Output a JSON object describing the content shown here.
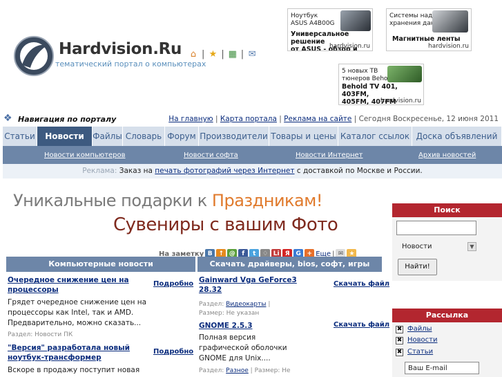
{
  "header": {
    "brand": "Hardvision.Ru",
    "tagline": "тематический портал о компьютерах",
    "tool_icons": [
      "home-icon",
      "star-icon",
      "document-icon",
      "mail-icon"
    ]
  },
  "ads": [
    {
      "text1": "Ноутбук",
      "text2": "ASUS A4B00G",
      "big1": "Универсальное решение",
      "big2": "от ASUS - обзор и тесты",
      "src": "hardvision.ru"
    },
    {
      "text1": "Системы надежного",
      "text2": "хранения данных",
      "big1": "Магнитные ленты",
      "big2": "",
      "src": "hardvision.ru"
    },
    {
      "text1": "5 новых ТВ",
      "text2": "тюнеров Beholder",
      "big1": "Behold TV 401, 403FM,",
      "big2": "405FM, 407FM",
      "src": "hardvision.ru"
    }
  ],
  "nav": {
    "title": "Навигация по порталу",
    "links": [
      "На главную",
      "Карта портала",
      "Реклама на сайте"
    ],
    "date": "Сегодня Воскресенье, 12 июня 2011",
    "tabs": [
      "Статьи",
      "Новости",
      "Файлы",
      "Словарь",
      "Форум",
      "Производители",
      "Товары и цены",
      "Каталог ссылок",
      "Доска объявлений"
    ],
    "active_tab": "Новости",
    "subnav": [
      "Новости компьютеров",
      "Новости софта",
      "Новости Интернет",
      "Архив новостей"
    ]
  },
  "promo": {
    "label": "Реклама:",
    "pre": "Заказ на",
    "link": "печать фотографий через Интернет",
    "post": "с доставкой по Москве и России."
  },
  "banner": {
    "line1_a": "Уникальные подарки к ",
    "line1_b": "Праздникам!",
    "line2": "Сувениры с вашим Фото"
  },
  "share": {
    "label": "На заметку",
    "more": "Еще"
  },
  "news": {
    "heading": "Компьютерные новости",
    "more_label": "Подробно",
    "items": [
      {
        "title1": "Очередное снижение цен на",
        "title2": "процессоры",
        "desc1": "Грядет очередное снижение цен на",
        "desc2": "процессоры как Intel, так и AMD.",
        "desc3": "Предварительно, можно сказать...",
        "meta": "Раздел: Новости ПК"
      },
      {
        "title1": "\"Версия\" разработала новый",
        "title2": "ноутбук-трансформер",
        "desc1": "Вскоре в продажу поступит новая",
        "desc2": "",
        "desc3": "",
        "meta": ""
      }
    ]
  },
  "downloads": {
    "heading": "Скачать драйверы, bios, софт, игры",
    "action_label": "Скачать файл",
    "items": [
      {
        "title1": "Gainward Vga GeForce3",
        "title2": "28.32",
        "section_label": "Раздел:",
        "section": "Видеокарты",
        "size": "Размер: Не указан",
        "desc1": "",
        "desc2": "",
        "desc3": ""
      },
      {
        "title1": "GNOME 2.5.3",
        "title2": "",
        "section_label": "Раздел:",
        "section": "Разное",
        "size": "Размер: Не",
        "desc1": "Полная версия",
        "desc2": "графической оболочки",
        "desc3": "GNOME для Unix...."
      }
    ]
  },
  "search": {
    "heading": "Поиск",
    "query": "",
    "select_value": "Новости",
    "button": "Найти!"
  },
  "mailing": {
    "heading": "Рассылка",
    "options": [
      "Файлы",
      "Новости",
      "Статьи"
    ],
    "email_placeholder": "Ваш E-mail"
  }
}
